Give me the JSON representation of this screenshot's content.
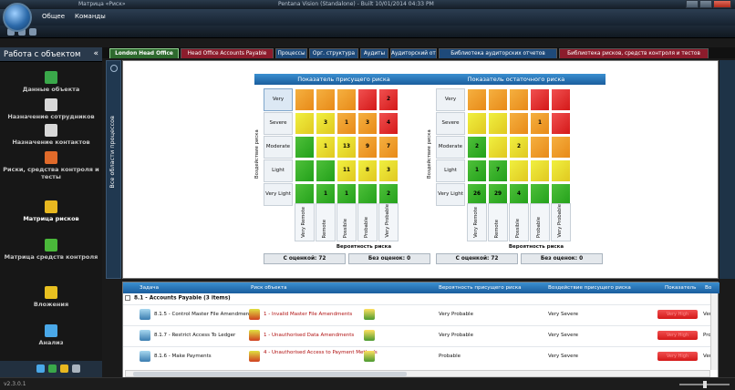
{
  "window": {
    "title_left": "Матрица «Риск»",
    "title_center": "Pentana Vision (Standalone) - Built 10/01/2014 04:33 PM"
  },
  "menu": {
    "items": [
      "Общее",
      "Команды"
    ]
  },
  "nav": {
    "header": "Работа с объектом",
    "collapse_glyph": "«",
    "items": [
      {
        "label": "Данные объекта",
        "icon": "data-object-icon",
        "color": "#3aa84a"
      },
      {
        "label": "Назначение сотрудников",
        "icon": "assign-employees-icon",
        "color": "#d8d8d8"
      },
      {
        "label": "Назначение контактов",
        "icon": "assign-contacts-icon",
        "color": "#d8d8d8"
      },
      {
        "label": "Риски, средства контроля и тесты",
        "icon": "risks-controls-icon",
        "color": "#e06a2a"
      },
      {
        "label": "Матрица рисков",
        "icon": "risk-matrix-icon",
        "color": "#e8b820",
        "active": true
      },
      {
        "label": "Матрица средств контроля",
        "icon": "control-matrix-icon",
        "color": "#4ab83a"
      },
      {
        "label": "Вложения",
        "icon": "attachments-icon",
        "color": "#e8c020"
      },
      {
        "label": "Анализ",
        "icon": "analysis-icon",
        "color": "#4aa8e8"
      }
    ]
  },
  "tabs": [
    {
      "label": "London Head Office",
      "color": "#2e6a2e",
      "active": true
    },
    {
      "label": "Head Office Accounts Payable",
      "color": "#8c1c2c"
    },
    {
      "label": "Процессы",
      "color": "#1e4a7a"
    },
    {
      "label": "Орг. структура",
      "color": "#1e4a7a"
    },
    {
      "label": "Аудиты",
      "color": "#1e4a7a"
    },
    {
      "label": "Аудиторский отчет",
      "color": "#1e4a7a"
    },
    {
      "label": "Библиотека аудиторских отчетов",
      "color": "#1e4a7a"
    },
    {
      "label": "Библиотека рисков, средств контроля и тестов",
      "color": "#8c1c2c"
    }
  ],
  "side_label": "Все области процессов",
  "matrices": [
    {
      "title": "Показатель присущего риска",
      "y_axis": "Воздействие риска",
      "x_axis": "Вероятность риска",
      "rows": [
        "Very Severe",
        "Severe",
        "Moderate",
        "Light",
        "Very Light"
      ],
      "cols": [
        "Very Remote",
        "Remote",
        "Possible",
        "Probable",
        "Very Probable"
      ],
      "selected_row": 0,
      "cells": [
        [
          [
            "o",
            ""
          ],
          [
            "o",
            ""
          ],
          [
            "o",
            ""
          ],
          [
            "r",
            ""
          ],
          [
            "r",
            "2"
          ]
        ],
        [
          [
            "y",
            ""
          ],
          [
            "y",
            "3"
          ],
          [
            "o",
            "1"
          ],
          [
            "o",
            "3"
          ],
          [
            "r",
            "4"
          ]
        ],
        [
          [
            "g",
            ""
          ],
          [
            "y",
            "1"
          ],
          [
            "y",
            "13"
          ],
          [
            "o",
            "9"
          ],
          [
            "o",
            "7"
          ]
        ],
        [
          [
            "g",
            ""
          ],
          [
            "g",
            ""
          ],
          [
            "y",
            "11"
          ],
          [
            "y",
            "8"
          ],
          [
            "y",
            "3"
          ]
        ],
        [
          [
            "g",
            ""
          ],
          [
            "g",
            "1"
          ],
          [
            "g",
            "1"
          ],
          [
            "g",
            ""
          ],
          [
            "g",
            "2"
          ]
        ]
      ],
      "rated_label": "С оценкой: 72",
      "unrated_label": "Без оценок: 0"
    },
    {
      "title": "Показатель остаточного риска",
      "y_axis": "Воздействие риска",
      "x_axis": "Вероятность риска",
      "rows": [
        "Very Severe",
        "Severe",
        "Moderate",
        "Light",
        "Very Light"
      ],
      "cols": [
        "Very Remote",
        "Remote",
        "Possible",
        "Probable",
        "Very Probable"
      ],
      "selected_row": -1,
      "cells": [
        [
          [
            "o",
            ""
          ],
          [
            "o",
            ""
          ],
          [
            "o",
            ""
          ],
          [
            "r",
            ""
          ],
          [
            "r",
            ""
          ]
        ],
        [
          [
            "y",
            ""
          ],
          [
            "y",
            ""
          ],
          [
            "o",
            ""
          ],
          [
            "o",
            "1"
          ],
          [
            "r",
            ""
          ]
        ],
        [
          [
            "g",
            "2"
          ],
          [
            "y",
            ""
          ],
          [
            "y",
            "2"
          ],
          [
            "o",
            ""
          ],
          [
            "o",
            ""
          ]
        ],
        [
          [
            "g",
            "1"
          ],
          [
            "g",
            "7"
          ],
          [
            "y",
            ""
          ],
          [
            "y",
            ""
          ],
          [
            "y",
            ""
          ]
        ],
        [
          [
            "g",
            "26"
          ],
          [
            "g",
            "29"
          ],
          [
            "g",
            "4"
          ],
          [
            "g",
            ""
          ],
          [
            "g",
            ""
          ]
        ]
      ],
      "rated_label": "С оценкой: 72",
      "unrated_label": "Без оценок: 0"
    }
  ],
  "table": {
    "columns": [
      "Задача",
      "Риск объекта",
      "Вероятность присущего риска",
      "Воздействие присущего риска",
      "Показатель",
      "Во"
    ],
    "group": "8.1 - Accounts Payable (3 items)",
    "rows": [
      {
        "task": "8.1.5 - Control Master File Amendments",
        "risk": "1 - Invalid Master File Amendments",
        "likelihood": "Very Probable",
        "impact": "Very Severe",
        "rating": "Very High",
        "extra": "Very"
      },
      {
        "task": "8.1.7 - Restrict Access To Ledger",
        "risk": "1 - Unauthorised Data Amendments",
        "likelihood": "Very Probable",
        "impact": "Very Severe",
        "rating": "Very High",
        "extra": "Prob"
      },
      {
        "task": "8.1.6 - Make Payments",
        "risk": "4 - Unauthorised Access to Payment Methods",
        "likelihood": "Probable",
        "impact": "Very Severe",
        "rating": "Very High",
        "extra": "Very"
      }
    ]
  },
  "status": {
    "version": "v2.3.0.1"
  }
}
